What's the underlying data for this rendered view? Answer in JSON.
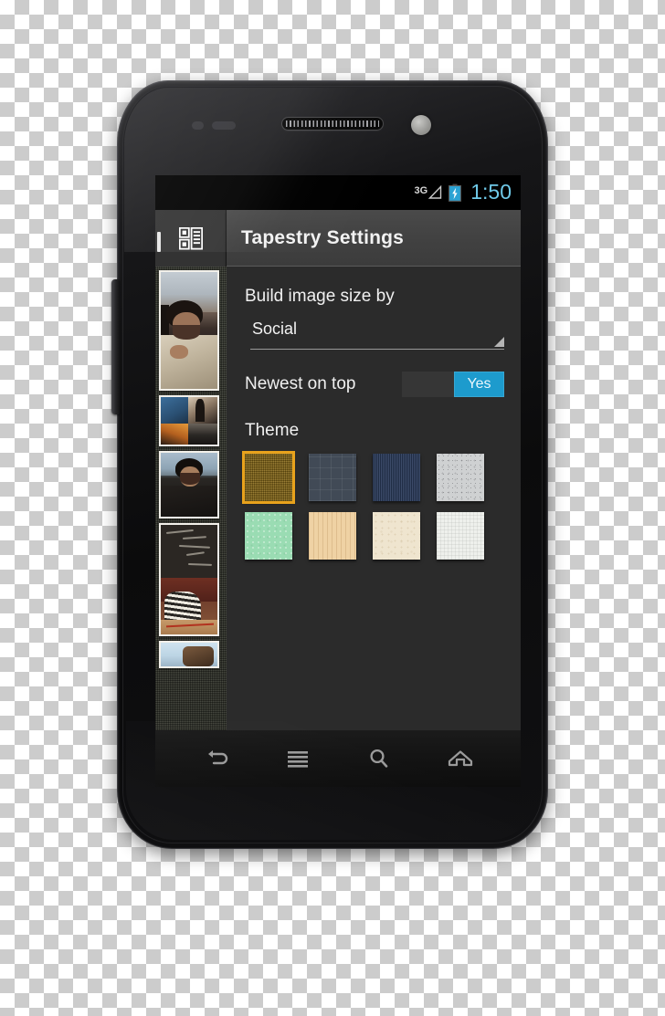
{
  "device": {
    "name": "android-smartphone",
    "hardware": {
      "earpiece": "earpiece-speaker",
      "front_camera": "front-camera",
      "volume_rocker": "volume-rocker"
    }
  },
  "status_bar": {
    "network_type": "3G",
    "signal_icon": "signal-triangle-icon",
    "battery_icon": "battery-charging-icon",
    "time": "1:50",
    "time_color": "#6fc9e8"
  },
  "action_bar": {
    "app_icon": "tapestry-grid-icon",
    "title": "Tapestry Settings"
  },
  "settings": {
    "image_size": {
      "label": "Build image size by",
      "selected": "Social",
      "dropdown_icon": "spinner-triangle-icon"
    },
    "newest_on_top": {
      "label": "Newest on top",
      "value": "Yes",
      "accent_color": "#1d9bcd"
    },
    "theme": {
      "label": "Theme",
      "selected_index": 0,
      "selection_color": "#e8a21c",
      "swatches": [
        {
          "name": "gold-burlap",
          "color": "#8a6a16",
          "selected": true
        },
        {
          "name": "slate-grid",
          "color": "#414a56",
          "selected": false
        },
        {
          "name": "navy-denim",
          "color": "#2b3c5c",
          "selected": false
        },
        {
          "name": "gray-speckle",
          "color": "#cfd1d2",
          "selected": false
        },
        {
          "name": "mint-green",
          "color": "#9adcb3",
          "selected": false
        },
        {
          "name": "tan-wood",
          "color": "#efd2a4",
          "selected": false
        },
        {
          "name": "cream-paper",
          "color": "#efe5cf",
          "selected": false
        },
        {
          "name": "white-linen",
          "color": "#eef0ec",
          "selected": false
        }
      ]
    }
  },
  "tapestry": {
    "name": "photo-tapestry-sidebar",
    "background": "#3c3f35",
    "photos": [
      {
        "name": "photo-man-cream-sweater"
      },
      {
        "name": "photo-collage-two-shots"
      },
      {
        "name": "photo-man-dark-shirt-beach"
      },
      {
        "name": "photo-chalkboard-striped-shirt"
      },
      {
        "name": "photo-partial-bottom"
      }
    ]
  },
  "nav_bar": {
    "buttons": [
      {
        "name": "back-button",
        "icon": "back-arrow-icon"
      },
      {
        "name": "menu-button",
        "icon": "menu-lines-icon"
      },
      {
        "name": "search-button",
        "icon": "search-magnifier-icon"
      },
      {
        "name": "home-button",
        "icon": "home-icon"
      }
    ]
  }
}
